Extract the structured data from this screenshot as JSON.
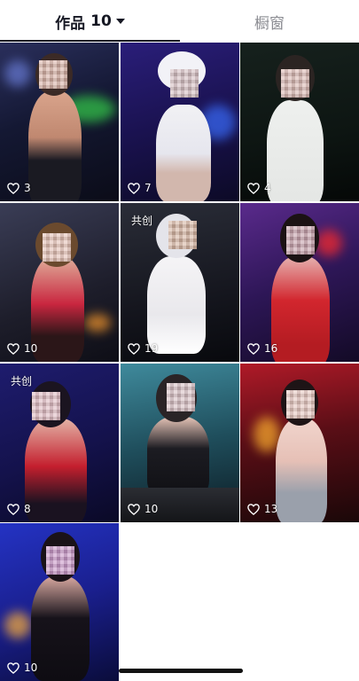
{
  "tabs": {
    "works_label": "作品",
    "works_count": "10",
    "window_label": "橱窗"
  },
  "videos": [
    {
      "likes": "3",
      "badge": ""
    },
    {
      "likes": "7",
      "badge": ""
    },
    {
      "likes": "4",
      "badge": ""
    },
    {
      "likes": "10",
      "badge": ""
    },
    {
      "likes": "19",
      "badge": "共创"
    },
    {
      "likes": "16",
      "badge": ""
    },
    {
      "likes": "8",
      "badge": "共创"
    },
    {
      "likes": "10",
      "badge": ""
    },
    {
      "likes": "13",
      "badge": ""
    },
    {
      "likes": "10",
      "badge": ""
    }
  ],
  "colors": {
    "active_tab": "#161823",
    "inactive_tab": "#8a8b91"
  },
  "icons": {
    "likes": "heart-outline-icon",
    "sort": "caret-down-icon"
  }
}
